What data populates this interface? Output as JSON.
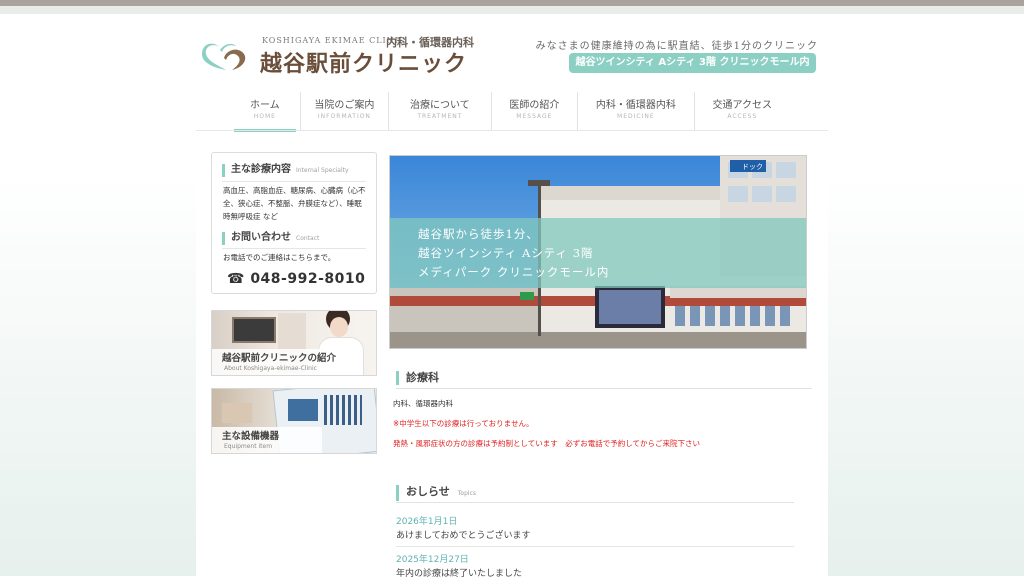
{
  "header": {
    "logo_en": "KOSHIGAYA EKIMAE CLINIC",
    "logo_dept": "内科・循環器内科",
    "logo_name": "越谷駅前クリニック",
    "tagline": "みなさまの健康維持の為に駅直結、徒歩1分のクリニック",
    "address_badge": "越谷ツインシティ Aシティ 3階 クリニックモール内",
    "colors": {
      "accent": "#8ccfc3",
      "logo_brown": "#6b4e3a"
    }
  },
  "nav": [
    {
      "jp": "ホーム",
      "en": "HOME"
    },
    {
      "jp": "当院のご案内",
      "en": "INFORMATION"
    },
    {
      "jp": "治療について",
      "en": "TREATMENT"
    },
    {
      "jp": "医師の紹介",
      "en": "MESSAGE"
    },
    {
      "jp": "内科・循環器内科",
      "en": "MEDICINE"
    },
    {
      "jp": "交通アクセス",
      "en": "ACCESS"
    }
  ],
  "sidebar": {
    "specialty_title": "主な診療内容",
    "specialty_sub": "Internal Specialty",
    "specialty_text": "高血圧、高脂血症、糖尿病、心臓病（心不全、狭心症、不整脈、弁膜症など）、睡眠時無呼吸症 など",
    "contact_title": "お問い合わせ",
    "contact_sub": "Contact",
    "contact_text": "お電話でのご連絡はこちらまで。",
    "phone": "☎ 048-992-8010",
    "banner_intro_title": "越谷駅前クリニックの紹介",
    "banner_intro_sub": "About Koshigaya-ekimae-Clinic",
    "banner_equip_title": "主な設備機器",
    "banner_equip_sub": "Equipment item"
  },
  "hero": {
    "line1": "越谷駅から徒歩1分、",
    "line2": "越谷ツインシティ Aシティ 3階",
    "line3": "メディパーク クリニックモール内",
    "store_sign": "ドック"
  },
  "departments": {
    "title": "診療科",
    "text": "内科、循環器内科",
    "notice1": "※中学生以下の診療は行っておりません。",
    "notice2": "発熱・風邪症状の方の診療は予約制としています　必ずお電話で予約してからご来院下さい"
  },
  "news": {
    "title": "おしらせ",
    "sub": "Topics",
    "items": [
      {
        "date": "2026年1月1日",
        "title": "あけましておめでとうございます"
      },
      {
        "date": "2025年12月27日",
        "title": "年内の診療は終了いたしました"
      }
    ]
  }
}
